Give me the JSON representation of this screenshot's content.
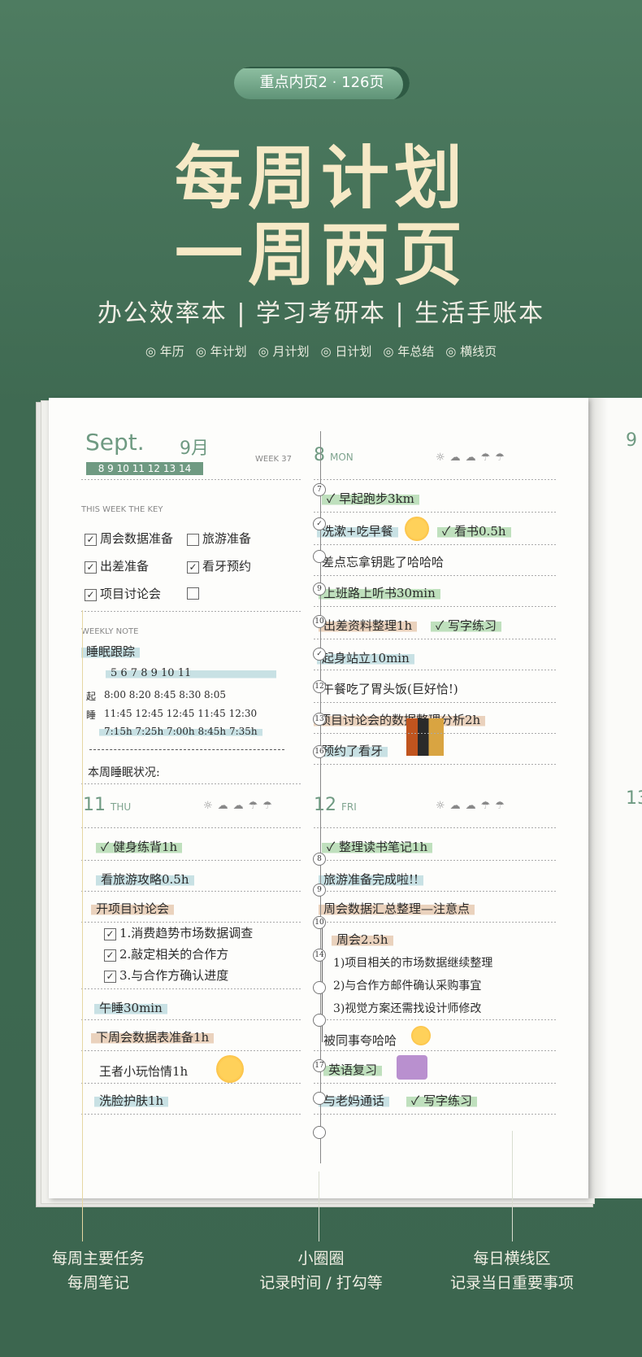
{
  "badge": "重点内页2 · 126页",
  "title": {
    "line1": "每周计划",
    "line2": "一周两页"
  },
  "subtitle": "办公效率本 | 学习考研本 | 生活手账本",
  "tags": [
    "◎ 年历",
    "◎ 年计划",
    "◎ 月计划",
    "◎ 日计划",
    "◎ 年总结",
    "◎ 横线页"
  ],
  "left": {
    "month_en": "Sept.",
    "month_cn": "9月",
    "dates": "8 9 10 11 12 13 14",
    "week": "WEEK 37",
    "key_title": "THIS WEEK THE KEY",
    "keys": [
      "周会数据准备",
      "旅游准备",
      "出差准备",
      "看牙预约",
      "项目讨论会",
      ""
    ],
    "note_title": "WEEKLY NOTE",
    "note_heading": "睡眠跟踪",
    "sleep_days": "5   6   7   8   9   10   11",
    "wake_label": "起",
    "wake": "8:00  8:20  8:45  8:30  8:05",
    "sleep_label": "睡",
    "sleep": "11:45 12:45 12:45 11:45 12:30",
    "hours": "7:15h 7:25h 7:00h 8:45h 7:35h",
    "status": "本周睡眠状况:"
  },
  "mon": {
    "num": "8",
    "label": "MON",
    "items": [
      "早起跑步3km",
      "洗漱+吃早餐",
      "看书0.5h",
      "差点忘拿钥匙了哈哈哈",
      "上班路上听书30min",
      "出差资料整理1h",
      "写字练习",
      "起身站立10min",
      "午餐吃了胃头饭(巨好恰!)",
      "项目讨论会的数据整理分析2h",
      "预约了看牙"
    ]
  },
  "thu": {
    "num": "11",
    "label": "THU",
    "items": [
      "健身练背1h",
      "看旅游攻略0.5h",
      "开项目讨论会",
      "1.消费趋势市场数据调查",
      "2.敲定相关的合作方",
      "3.与合作方确认进度",
      "午睡30min",
      "下周会数据表准备1h",
      "王者小玩怡情1h",
      "洗脸护肤1h"
    ]
  },
  "fri": {
    "num": "12",
    "label": "FRI",
    "items": [
      "整理读书笔记1h",
      "旅游准备完成啦!!",
      "周会数据汇总整理—注意点",
      "周会2.5h",
      "1)项目相关的市场数据继续整理",
      "2)与合作方邮件确认采购事宜",
      "3)视觉方案还需找设计师修改",
      "被同事夸哈哈",
      "英语复习",
      "与老妈通话",
      "写字练习"
    ]
  },
  "times_mon": [
    "7",
    "",
    "",
    "9",
    "10",
    "",
    "12",
    "13",
    "16"
  ],
  "times_fri": [
    "8",
    "9",
    "10",
    "14",
    "",
    "",
    "17",
    "",
    ""
  ],
  "edge": {
    "num_top": "9",
    "num_bot": "13"
  },
  "captions": [
    {
      "l1": "每周主要任务",
      "l2": "每周笔记"
    },
    {
      "l1": "小圈圈",
      "l2": "记录时间 / 打勾等"
    },
    {
      "l1": "每日横线区",
      "l2": "记录当日重要事项"
    }
  ]
}
